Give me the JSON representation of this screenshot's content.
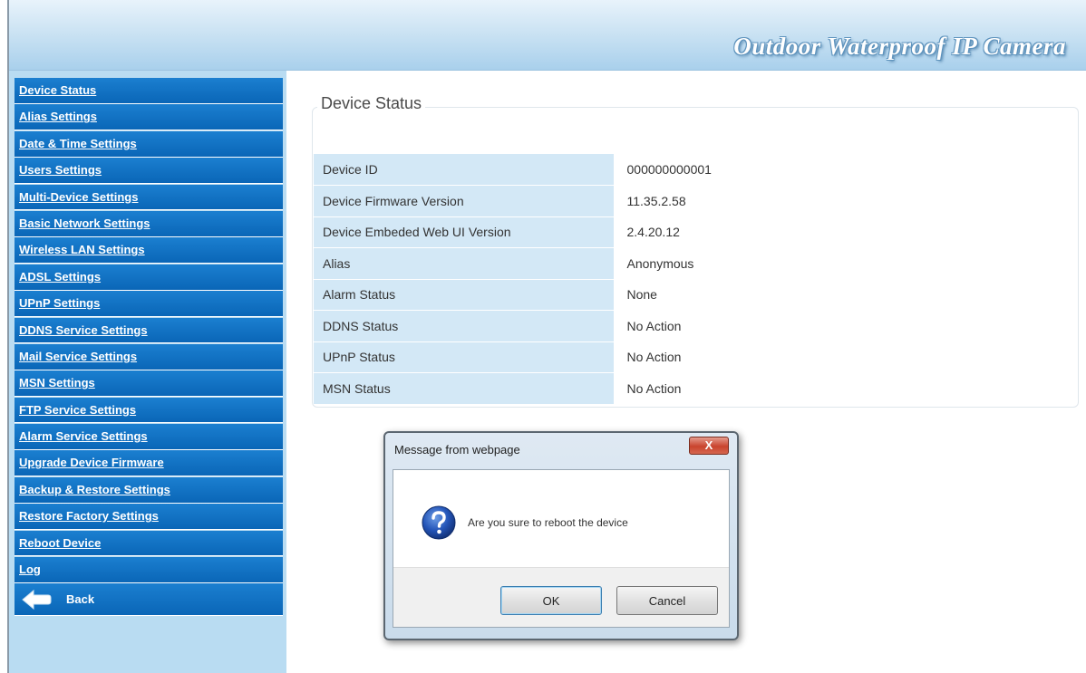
{
  "header": {
    "title": "Outdoor Waterproof IP Camera"
  },
  "sidebar": {
    "items": [
      "Device Status",
      "Alias Settings",
      "Date & Time Settings",
      "Users Settings",
      "Multi-Device Settings",
      "Basic Network Settings",
      "Wireless LAN Settings",
      "ADSL Settings",
      "UPnP Settings",
      "DDNS Service Settings",
      "Mail Service Settings",
      "MSN Settings",
      "FTP Service Settings",
      "Alarm Service Settings",
      "Upgrade Device Firmware",
      "Backup & Restore Settings",
      "Restore Factory Settings",
      "Reboot Device",
      "Log"
    ],
    "back_label": "Back"
  },
  "main": {
    "section_title": "Device Status",
    "rows": [
      {
        "label": "Device ID",
        "value": "000000000001"
      },
      {
        "label": "Device Firmware Version",
        "value": "11.35.2.58"
      },
      {
        "label": "Device Embeded Web UI Version",
        "value": "2.4.20.12"
      },
      {
        "label": "Alias",
        "value": "Anonymous"
      },
      {
        "label": "Alarm Status",
        "value": "None"
      },
      {
        "label": "DDNS Status",
        "value": "No Action"
      },
      {
        "label": "UPnP Status",
        "value": "No Action"
      },
      {
        "label": "MSN Status",
        "value": "No Action"
      }
    ]
  },
  "dialog": {
    "title": "Message from webpage",
    "close_label": "X",
    "message": "Are you sure to reboot the device",
    "ok_label": "OK",
    "cancel_label": "Cancel"
  }
}
